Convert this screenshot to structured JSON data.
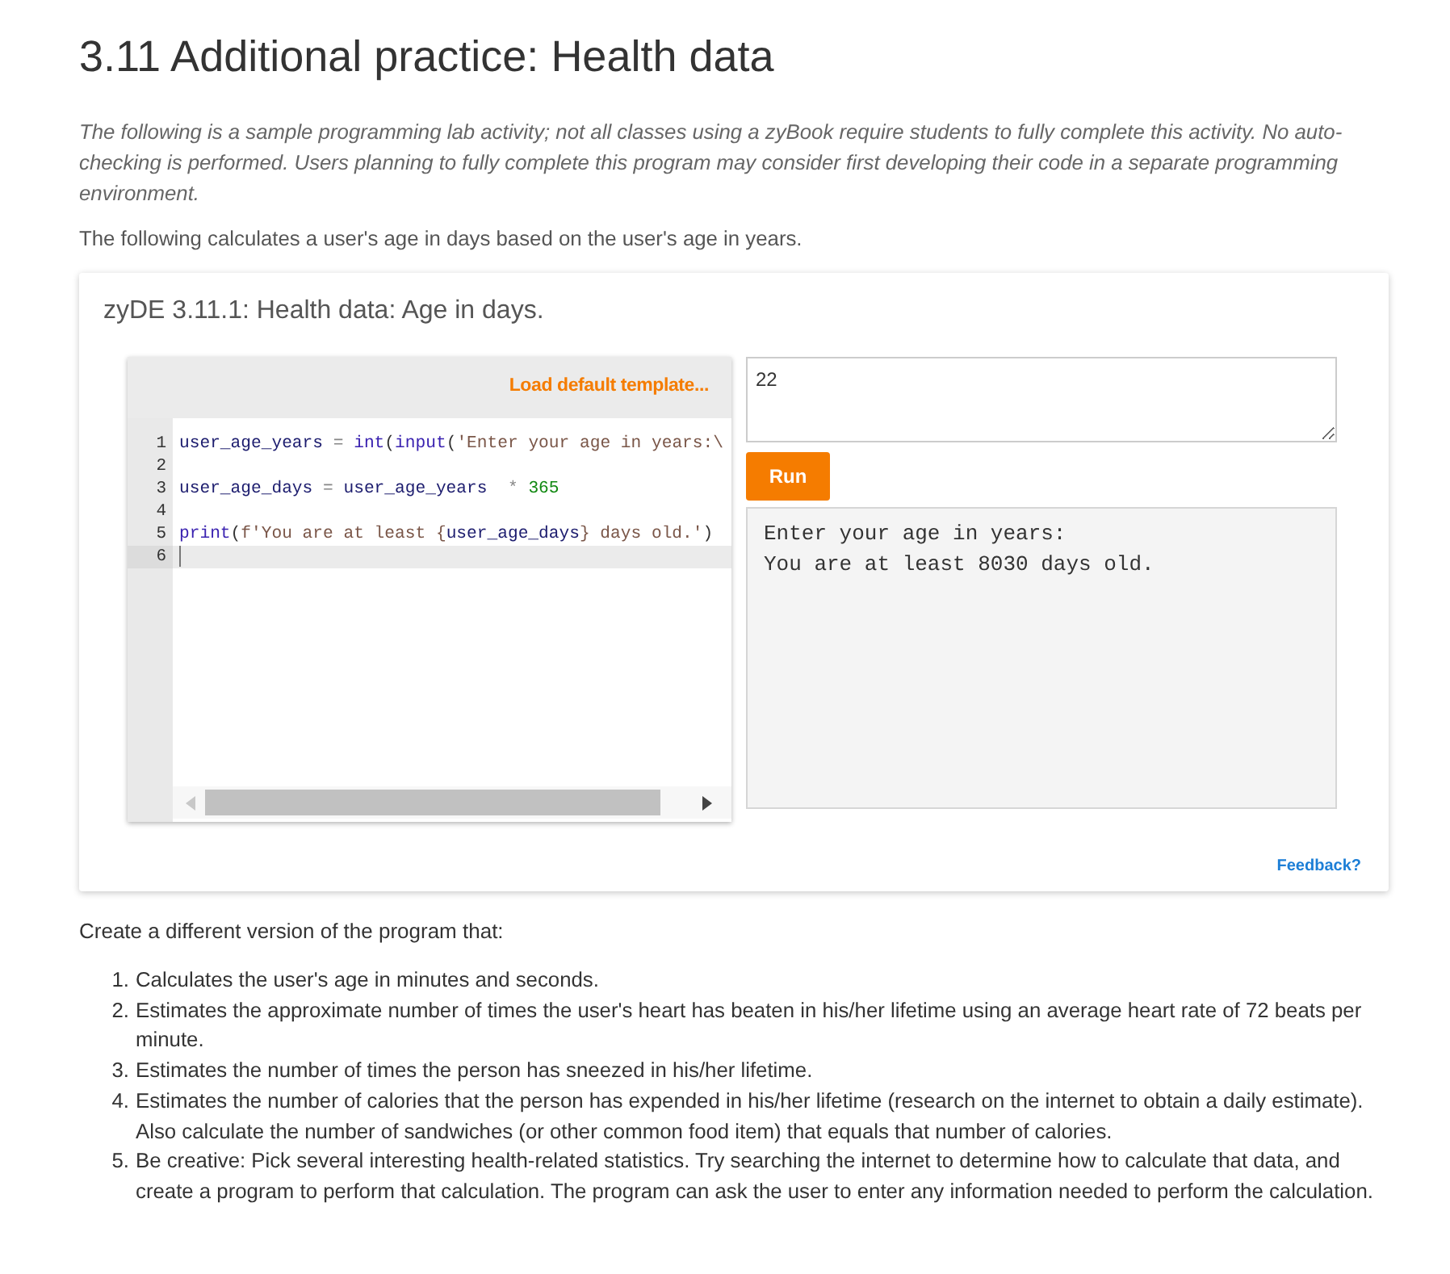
{
  "page_title": "3.11 Additional practice: Health data",
  "intro": {
    "note": "The following is a sample programming lab activity; not all classes using a zyBook require students to fully complete this activity. No auto-checking is performed. Users planning to fully complete this program may consider first developing their code in a separate programming environment.",
    "description": "The following calculates a user's age in days based on the user's age in years."
  },
  "zyde": {
    "title": "zyDE 3.11.1: Health data: Age in days.",
    "editor": {
      "toolbar_link": "Load default template...",
      "lines": [
        {
          "number": "1",
          "active": false,
          "tokens": [
            {
              "kind": "variable",
              "text": "user_age_years"
            },
            {
              "kind": "operator",
              "text": " = "
            },
            {
              "kind": "builtin",
              "text": "int"
            },
            {
              "kind": "punct",
              "text": "("
            },
            {
              "kind": "builtin",
              "text": "input"
            },
            {
              "kind": "punct",
              "text": "("
            },
            {
              "kind": "string",
              "text": "'Enter your age in years:\\"
            }
          ]
        },
        {
          "number": "2",
          "active": false
        },
        {
          "number": "3",
          "active": false,
          "tokens": [
            {
              "kind": "variable",
              "text": "user_age_days"
            },
            {
              "kind": "operator",
              "text": " = "
            },
            {
              "kind": "variable",
              "text": "user_age_years"
            },
            {
              "kind": "operator",
              "text": "  * "
            },
            {
              "kind": "number",
              "text": "365"
            }
          ]
        },
        {
          "number": "4",
          "active": false
        },
        {
          "number": "5",
          "active": false,
          "tokens": [
            {
              "kind": "builtin",
              "text": "print"
            },
            {
              "kind": "punct",
              "text": "("
            },
            {
              "kind": "string",
              "text": "f'You are at least {"
            },
            {
              "kind": "variable",
              "text": "user_age_days"
            },
            {
              "kind": "string",
              "text": "} days old.'"
            },
            {
              "kind": "punct",
              "text": ")"
            }
          ]
        },
        {
          "number": "6",
          "active": true
        }
      ]
    },
    "input": {
      "value": "22"
    },
    "run_button": "Run",
    "output": [
      "Enter your age in years:",
      "You are at least 8030 days old."
    ],
    "feedback_link": "Feedback?"
  },
  "instructions": {
    "lead": "Create a different version of the program that:",
    "items": [
      {
        "number": "1.",
        "text": "Calculates the user's age in minutes and seconds."
      },
      {
        "number": "2.",
        "text": "Estimates the approximate number of times the user's heart has beaten in his/her lifetime using an average heart rate of 72 beats per minute."
      },
      {
        "number": "3.",
        "text": "Estimates the number of times the person has sneezed in his/her lifetime."
      },
      {
        "number": "4.",
        "text": "Estimates the number of calories that the person has expended in his/her lifetime (research on the internet to obtain a daily estimate). Also calculate the number of sandwiches (or other common food item) that equals that number of calories."
      },
      {
        "number": "5.",
        "text": "Be creative: Pick several interesting health-related statistics. Try searching the internet to determine how to calculate that data, and create a program to perform that calculation. The program can ask the user to enter any information needed to perform the calculation."
      }
    ]
  }
}
